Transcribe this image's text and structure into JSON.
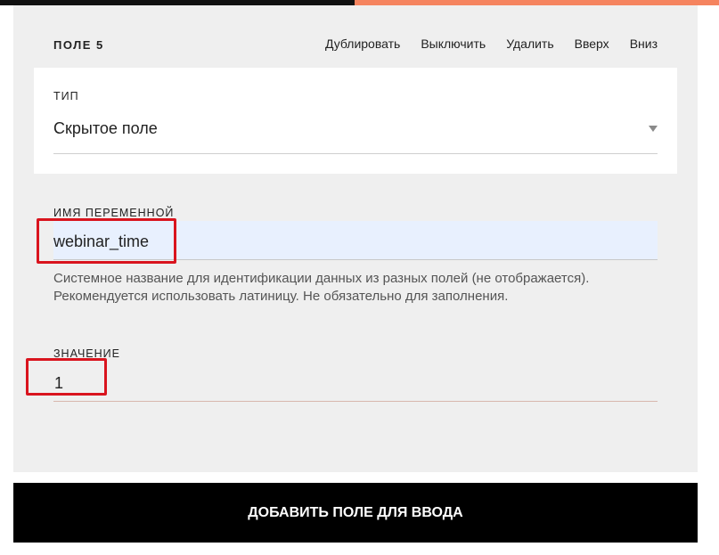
{
  "field": {
    "title": "ПОЛЕ 5",
    "actions": [
      {
        "label": "Дублировать"
      },
      {
        "label": "Выключить"
      },
      {
        "label": "Удалить"
      },
      {
        "label": "Вверх"
      },
      {
        "label": "Вниз"
      }
    ]
  },
  "type": {
    "label": "ТИП",
    "value": "Скрытое поле"
  },
  "variable": {
    "label": "ИМЯ ПЕРЕМЕННОЙ",
    "value": "webinar_time",
    "hint_line1": "Системное название для идентификации данных из разных полей (не отображается).",
    "hint_line2": "Рекомендуется использовать латиницу. Не обязательно для заполнения."
  },
  "value_field": {
    "label": "ЗНАЧЕНИЕ",
    "value": "1"
  },
  "add_button": {
    "label": "ДОБАВИТЬ ПОЛЕ ДЛЯ ВВОДА"
  },
  "colors": {
    "accent": "#f5845f",
    "highlight": "#d9141e",
    "autofill": "#e8f0fe"
  }
}
